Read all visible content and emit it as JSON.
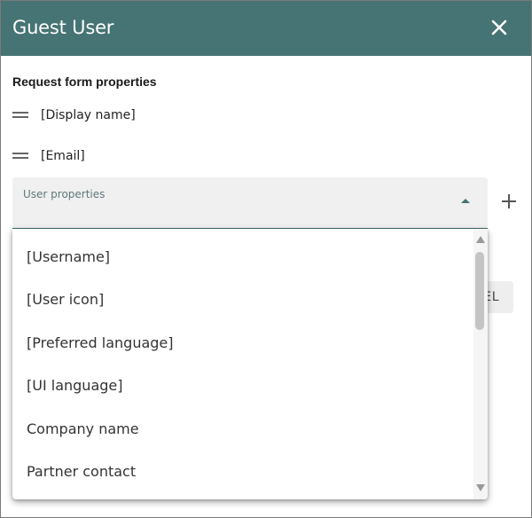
{
  "dialog": {
    "title": "Guest User",
    "close_icon": "close-icon"
  },
  "form": {
    "section_title": "Request form properties",
    "fields": [
      {
        "label": "[Display name]",
        "icon": "drag-handle-icon"
      },
      {
        "label": "[Email]",
        "icon": "drag-handle-icon"
      }
    ],
    "select": {
      "label": "User properties",
      "arrow_icon": "arrow-up-icon"
    },
    "add_icon": "plus-icon",
    "obscured_button_text": "EL"
  },
  "dropdown": {
    "options": [
      "[Username]",
      "[User icon]",
      "[Preferred language]",
      "[UI language]",
      "Company name",
      "Partner contact"
    ],
    "scroll_up_icon": "scroll-up-icon",
    "scroll_down_icon": "scroll-down-icon"
  },
  "colors": {
    "header_bg": "#467373",
    "accent": "#467373"
  }
}
